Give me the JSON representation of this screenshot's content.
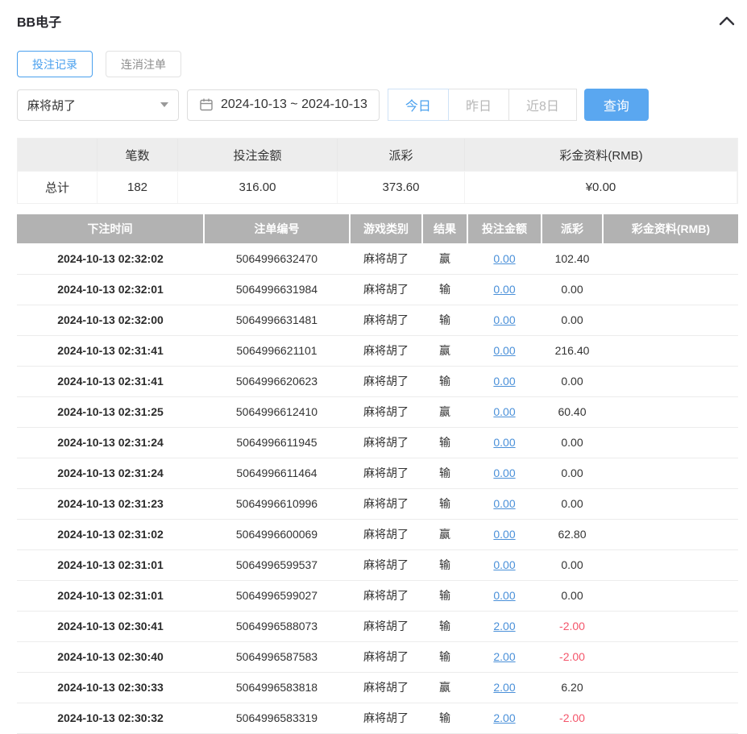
{
  "header": {
    "title": "BB电子"
  },
  "tabs": {
    "betting_records": "投注记录",
    "combo_orders": "连消注单"
  },
  "filters": {
    "game_selected": "麻将胡了",
    "date_range": "2024-10-13 ~ 2024-10-13",
    "today": "今日",
    "yesterday": "昨日",
    "last8": "近8日",
    "query": "查询"
  },
  "summary": {
    "col_count": "笔数",
    "col_bet": "投注金额",
    "col_payout": "派彩",
    "col_bonus": "彩金资料(RMB)",
    "total_label": "总计",
    "count": "182",
    "bet_amount": "316.00",
    "payout": "373.60",
    "bonus": "¥0.00"
  },
  "table": {
    "headers": {
      "time": "下注时间",
      "order": "注单编号",
      "game": "游戏类别",
      "result": "结果",
      "bet": "投注金额",
      "payout": "派彩",
      "bonus": "彩金资料(RMB)"
    },
    "rows": [
      {
        "time": "2024-10-13 02:32:02",
        "order": "5064996632470",
        "game": "麻将胡了",
        "result": "赢",
        "bet": "0.00",
        "payout": "102.40",
        "bonus": "",
        "negative": false
      },
      {
        "time": "2024-10-13 02:32:01",
        "order": "5064996631984",
        "game": "麻将胡了",
        "result": "输",
        "bet": "0.00",
        "payout": "0.00",
        "bonus": "",
        "negative": false
      },
      {
        "time": "2024-10-13 02:32:00",
        "order": "5064996631481",
        "game": "麻将胡了",
        "result": "输",
        "bet": "0.00",
        "payout": "0.00",
        "bonus": "",
        "negative": false
      },
      {
        "time": "2024-10-13 02:31:41",
        "order": "5064996621101",
        "game": "麻将胡了",
        "result": "赢",
        "bet": "0.00",
        "payout": "216.40",
        "bonus": "",
        "negative": false
      },
      {
        "time": "2024-10-13 02:31:41",
        "order": "5064996620623",
        "game": "麻将胡了",
        "result": "输",
        "bet": "0.00",
        "payout": "0.00",
        "bonus": "",
        "negative": false
      },
      {
        "time": "2024-10-13 02:31:25",
        "order": "5064996612410",
        "game": "麻将胡了",
        "result": "赢",
        "bet": "0.00",
        "payout": "60.40",
        "bonus": "",
        "negative": false
      },
      {
        "time": "2024-10-13 02:31:24",
        "order": "5064996611945",
        "game": "麻将胡了",
        "result": "输",
        "bet": "0.00",
        "payout": "0.00",
        "bonus": "",
        "negative": false
      },
      {
        "time": "2024-10-13 02:31:24",
        "order": "5064996611464",
        "game": "麻将胡了",
        "result": "输",
        "bet": "0.00",
        "payout": "0.00",
        "bonus": "",
        "negative": false
      },
      {
        "time": "2024-10-13 02:31:23",
        "order": "5064996610996",
        "game": "麻将胡了",
        "result": "输",
        "bet": "0.00",
        "payout": "0.00",
        "bonus": "",
        "negative": false
      },
      {
        "time": "2024-10-13 02:31:02",
        "order": "5064996600069",
        "game": "麻将胡了",
        "result": "赢",
        "bet": "0.00",
        "payout": "62.80",
        "bonus": "",
        "negative": false
      },
      {
        "time": "2024-10-13 02:31:01",
        "order": "5064996599537",
        "game": "麻将胡了",
        "result": "输",
        "bet": "0.00",
        "payout": "0.00",
        "bonus": "",
        "negative": false
      },
      {
        "time": "2024-10-13 02:31:01",
        "order": "5064996599027",
        "game": "麻将胡了",
        "result": "输",
        "bet": "0.00",
        "payout": "0.00",
        "bonus": "",
        "negative": false
      },
      {
        "time": "2024-10-13 02:30:41",
        "order": "5064996588073",
        "game": "麻将胡了",
        "result": "输",
        "bet": "2.00",
        "payout": "-2.00",
        "bonus": "",
        "negative": true
      },
      {
        "time": "2024-10-13 02:30:40",
        "order": "5064996587583",
        "game": "麻将胡了",
        "result": "输",
        "bet": "2.00",
        "payout": "-2.00",
        "bonus": "",
        "negative": true
      },
      {
        "time": "2024-10-13 02:30:33",
        "order": "5064996583818",
        "game": "麻将胡了",
        "result": "赢",
        "bet": "2.00",
        "payout": "6.20",
        "bonus": "",
        "negative": false
      },
      {
        "time": "2024-10-13 02:30:32",
        "order": "5064996583319",
        "game": "麻将胡了",
        "result": "输",
        "bet": "2.00",
        "payout": "-2.00",
        "bonus": "",
        "negative": true
      }
    ]
  },
  "colors": {
    "accent": "#4aa0ee",
    "link": "#4a90d9",
    "negative": "#f4566b",
    "thead": "#b2b2b2"
  }
}
